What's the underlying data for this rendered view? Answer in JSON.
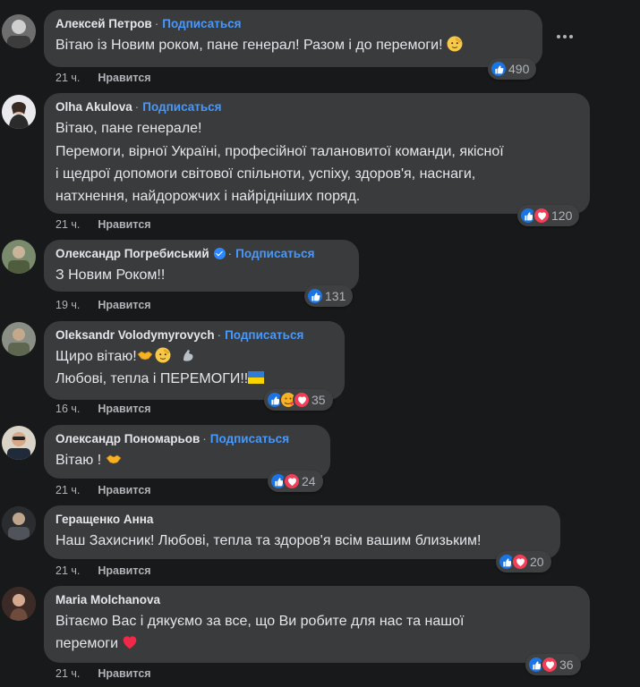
{
  "comments": [
    {
      "author": "Алексей Петров",
      "follow": "Подписаться",
      "lines": [
        "Вітаю із Новим роком, пане генерал! Разом і до перемоги!"
      ],
      "time": "21 ч.",
      "like": "Нравится",
      "reaction_count": "490",
      "reactions": [
        "like"
      ],
      "inline_emoji": [
        "salute-face"
      ]
    },
    {
      "author": "Olha Akulova",
      "follow": "Подписаться",
      "lines": [
        "Вітаю, пане генерале!",
        "Перемоги, вірної Україні, професійної талановитої команди, якісної",
        "і щедрої допомоги світової спільноти, успіху, здоров'я, наснаги,",
        "натхнення, найдорожчих і найрідніших поряд."
      ],
      "time": "21 ч.",
      "like": "Нравится",
      "reaction_count": "120",
      "reactions": [
        "like",
        "love"
      ]
    },
    {
      "author": "Олександр Погребиський",
      "verified": true,
      "follow": "Подписаться",
      "lines": [
        "З Новим Роком!!"
      ],
      "time": "19 ч.",
      "like": "Нравится",
      "reaction_count": "131",
      "reactions": [
        "like"
      ]
    },
    {
      "author": "Oleksandr Volodymyrovych",
      "follow": "Подписаться",
      "lines": [
        "Щиро вітаю!",
        "Любові, тепла і ПЕРЕМОГИ!!"
      ],
      "time": "16 ч.",
      "like": "Нравится",
      "reaction_count": "35",
      "reactions": [
        "like",
        "care",
        "love"
      ],
      "inline_emoji": [
        "handshake",
        "salute-face",
        "flexed-arm",
        "ukraine-flag"
      ]
    },
    {
      "author": "Олександр Пономарьов",
      "follow": "Подписаться",
      "lines": [
        "Вітаю !"
      ],
      "time": "21 ч.",
      "like": "Нравится",
      "reaction_count": "24",
      "reactions": [
        "like",
        "love"
      ],
      "inline_emoji": [
        "handshake"
      ]
    },
    {
      "author": "Геращенко Анна",
      "lines": [
        "Наш Захисник! Любові, тепла та здоров'я всім вашим близьким!"
      ],
      "time": "21 ч.",
      "like": "Нравится",
      "reaction_count": "20",
      "reactions": [
        "like",
        "love"
      ]
    },
    {
      "author": "Maria Molchanova",
      "lines": [
        "Вітаємо Вас і дякуємо за все, що Ви робите для нас та нашої",
        "перемоги"
      ],
      "time": "21 ч.",
      "like": "Нравится",
      "reaction_count": "36",
      "reactions": [
        "like",
        "love"
      ],
      "inline_emoji": [
        "red-heart"
      ]
    }
  ],
  "colors": {
    "background": "#18191a",
    "bubble": "#3a3b3c",
    "follow": "#4599ff",
    "like": "#1b74e4",
    "love": "#f33e58"
  }
}
